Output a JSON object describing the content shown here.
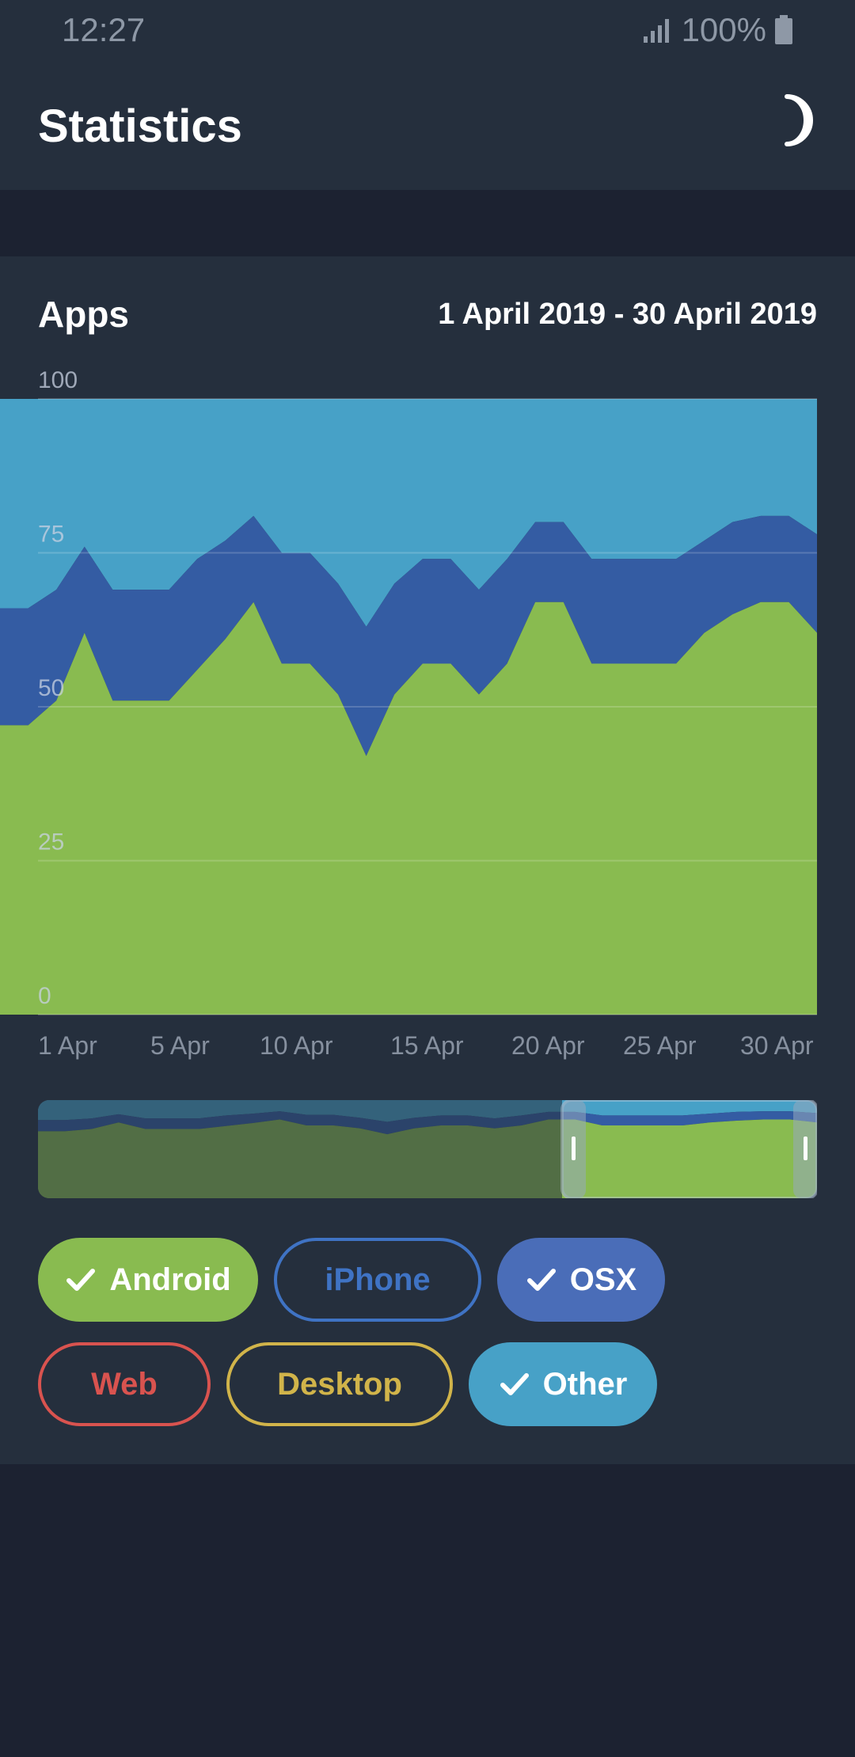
{
  "status": {
    "time": "12:27",
    "battery": "100%",
    "signal_icon": "signal-icon",
    "battery_icon": "battery-icon"
  },
  "appbar": {
    "title": "Statistics",
    "night_icon": "moon-icon"
  },
  "card": {
    "title": "Apps",
    "date_range": "1 April 2019 - 30 April 2019"
  },
  "colors": {
    "background": "#1c2231",
    "card": "#252f3d",
    "android": "#89bb50",
    "iphone": "#3f73c4",
    "osx": "#345ca3",
    "other": "#47a1c7",
    "web": "#d9534f",
    "desktop": "#d1b44a"
  },
  "filters": [
    {
      "label": "Android",
      "active": true,
      "color": "#89bb50"
    },
    {
      "label": "iPhone",
      "active": false,
      "color": "#3f73c4"
    },
    {
      "label": "OSX",
      "active": true,
      "color": "#4a6db8"
    },
    {
      "label": "Web",
      "active": false,
      "color": "#d9534f"
    },
    {
      "label": "Desktop",
      "active": false,
      "color": "#d1b44a"
    },
    {
      "label": "Other",
      "active": true,
      "color": "#47a1c7"
    }
  ],
  "chart_data": {
    "type": "area",
    "stacked": true,
    "percentage": true,
    "x": [
      "1 Apr",
      "2 Apr",
      "3 Apr",
      "4 Apr",
      "5 Apr",
      "6 Apr",
      "7 Apr",
      "8 Apr",
      "9 Apr",
      "10 Apr",
      "11 Apr",
      "12 Apr",
      "13 Apr",
      "14 Apr",
      "15 Apr",
      "16 Apr",
      "17 Apr",
      "18 Apr",
      "19 Apr",
      "20 Apr",
      "21 Apr",
      "22 Apr",
      "23 Apr",
      "24 Apr",
      "25 Apr",
      "26 Apr",
      "27 Apr",
      "28 Apr",
      "29 Apr",
      "30 Apr"
    ],
    "x_tick_labels": [
      "1 Apr",
      "5 Apr",
      "10 Apr",
      "15 Apr",
      "20 Apr",
      "25 Apr",
      "30 Apr"
    ],
    "y_tick_labels": [
      "0",
      "25",
      "50",
      "75",
      "100"
    ],
    "ylim": [
      0,
      100
    ],
    "grid": true,
    "series": [
      {
        "name": "Android",
        "color": "#89bb50",
        "values": [
          47,
          47,
          51,
          62,
          51,
          51,
          51,
          56,
          61,
          67,
          57,
          57,
          52,
          42,
          52,
          57,
          57,
          52,
          57,
          67,
          67,
          57,
          57,
          57,
          57,
          62,
          65,
          67,
          67,
          62
        ]
      },
      {
        "name": "OSX",
        "color": "#345ca3",
        "values": [
          19,
          19,
          18,
          14,
          18,
          18,
          18,
          18,
          16,
          14,
          18,
          18,
          18,
          21,
          18,
          17,
          17,
          17,
          17,
          13,
          13,
          17,
          17,
          17,
          17,
          15,
          15,
          14,
          14,
          16
        ]
      },
      {
        "name": "Other",
        "color": "#47a1c7",
        "values": [
          34,
          34,
          31,
          24,
          31,
          31,
          31,
          26,
          23,
          19,
          25,
          25,
          30,
          37,
          30,
          26,
          26,
          31,
          26,
          20,
          20,
          26,
          26,
          26,
          26,
          23,
          20,
          19,
          19,
          22
        ]
      }
    ],
    "series_30apr_last_android": 56
  }
}
